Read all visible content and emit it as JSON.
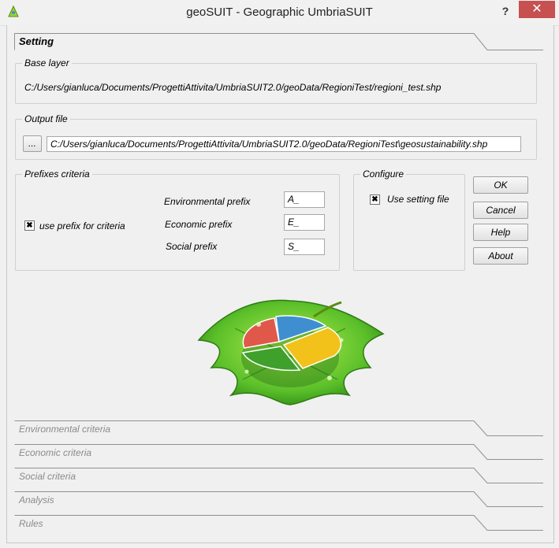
{
  "window": {
    "title": "geoSUIT - Geographic UmbriaSUIT",
    "help_label": "?",
    "close_label": "✕"
  },
  "setting_tab": {
    "label": "Setting"
  },
  "base_layer": {
    "title": "Base layer",
    "path": "C:/Users/gianluca/Documents/ProgettiAttivita/UmbriaSUIT2.0/geoData/RegioniTest/regioni_test.shp"
  },
  "output_file": {
    "title": "Output file",
    "browse_label": "...",
    "path": "C:/Users/gianluca/Documents/ProgettiAttivita/UmbriaSUIT2.0/geoData/RegioniTest\\geosustainability.shp"
  },
  "prefixes": {
    "title": "Prefixes criteria",
    "use_prefix_label": "use prefix for criteria",
    "use_prefix_mark": "✖",
    "environmental_label": "Environmental  prefix",
    "environmental_value": "A_",
    "economic_label": "Economic prefix",
    "economic_value": "E_",
    "social_label": "Social prefix",
    "social_value": "S_"
  },
  "configure": {
    "title": "Configure",
    "use_setting_label": "Use setting file",
    "use_setting_mark": "✖"
  },
  "buttons": {
    "ok": "OK",
    "cancel": "Cancel",
    "help": "Help",
    "about": "About"
  },
  "tabs": [
    {
      "label": "Environmental criteria"
    },
    {
      "label": "Economic criteria"
    },
    {
      "label": "Social criteria"
    },
    {
      "label": "Analysis"
    },
    {
      "label": "Rules"
    }
  ],
  "colors": {
    "leaf_green": "#5bbf2a",
    "pie_red": "#e0584a",
    "pie_blue": "#3f8fd0",
    "pie_yellow": "#f2c21a",
    "pie_green": "#3fa02c"
  }
}
